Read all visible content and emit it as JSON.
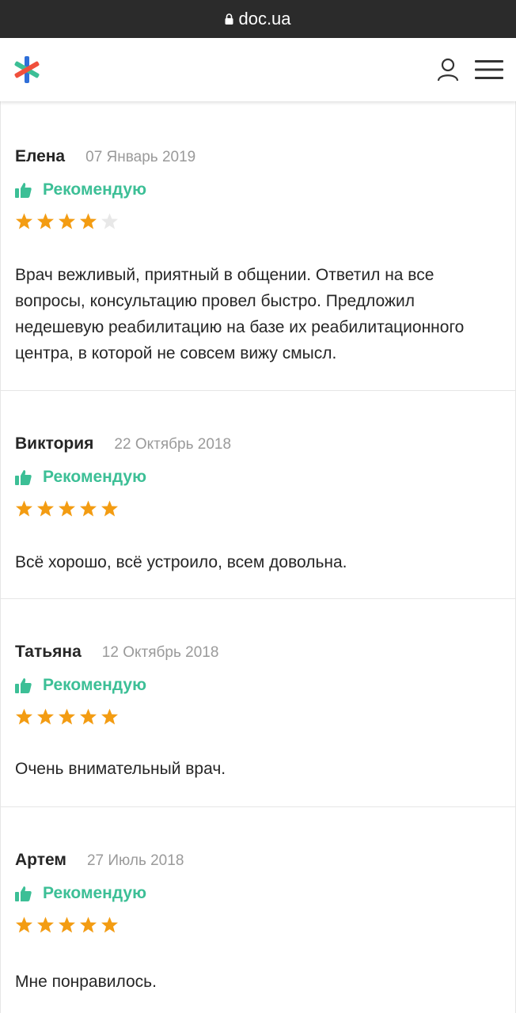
{
  "browser": {
    "url": "doc.ua"
  },
  "colors": {
    "accent": "#3cbf96",
    "star_on": "#f39c12",
    "star_off": "#e8e8e8"
  },
  "icons": {
    "logo": "doc-ua-logo-icon",
    "user": "user-icon",
    "menu": "hamburger-menu-icon",
    "thumb": "thumbs-up-icon",
    "star": "star-icon",
    "lock": "lock-icon"
  },
  "reviews": [
    {
      "author": "Елена",
      "date": "07 Январь 2019",
      "recommend": "Рекомендую",
      "rating": 4,
      "text": "Врач вежливый, приятный в общении. Ответил на все вопросы, консультацию провел быстро. Предложил недешевую реабилитацию на базе их реабилитационного центра, в которой не совсем вижу смысл."
    },
    {
      "author": "Виктория",
      "date": "22 Октябрь 2018",
      "recommend": "Рекомендую",
      "rating": 5,
      "text": "Всё хорошо, всё устроило, всем довольна."
    },
    {
      "author": "Татьяна",
      "date": "12 Октябрь 2018",
      "recommend": "Рекомендую",
      "rating": 5,
      "text": "Очень внимательный врач."
    },
    {
      "author": "Артем",
      "date": "27 Июль 2018",
      "recommend": "Рекомендую",
      "rating": 5,
      "text": "Мне понравилось."
    }
  ]
}
